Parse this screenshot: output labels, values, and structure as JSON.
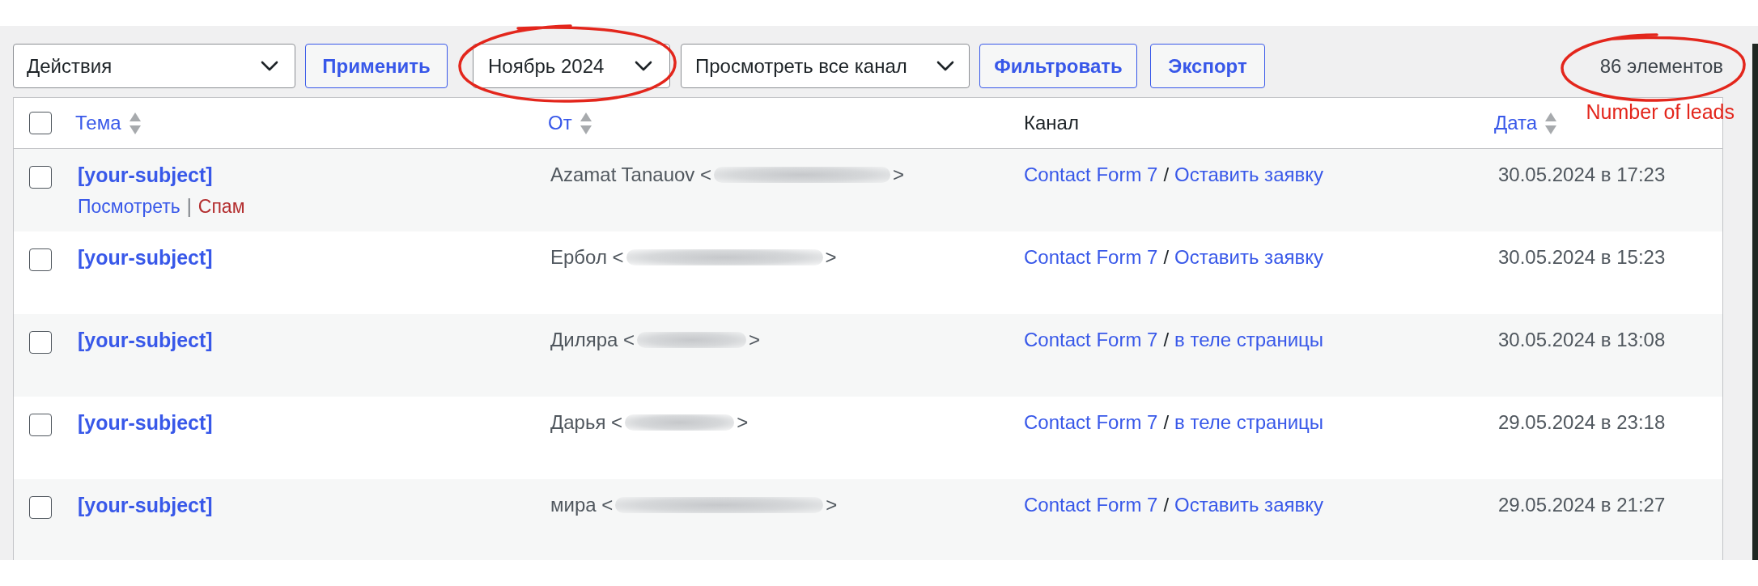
{
  "toolbar": {
    "bulk_action": {
      "value": "Действия"
    },
    "apply_button": {
      "label": "Применить"
    },
    "month_filter": {
      "value": "Ноябрь 2024",
      "circled": true
    },
    "channel_filter": {
      "value": "Просмотреть все канал"
    },
    "filter_button": {
      "label": "Фильтровать"
    },
    "export_button": {
      "label": "Экспорт"
    },
    "item_count": {
      "text": "86 элементов",
      "circled": true,
      "note": "Number of leads"
    }
  },
  "table": {
    "select_all": {
      "checked": false
    },
    "columns": [
      {
        "label": "Тема",
        "sortable": true
      },
      {
        "label": "От",
        "sortable": true
      },
      {
        "label": "Канал",
        "sortable": false
      },
      {
        "label": "Дата",
        "sortable": true
      }
    ],
    "rows": [
      {
        "checked": false,
        "subject": "[your-subject]",
        "actions": [
          {
            "label": "Посмотреть",
            "kind": "view"
          },
          {
            "label": "Спам",
            "kind": "spam"
          }
        ],
        "action_separator": "|",
        "sender": {
          "before": "Azamat Tanauov <",
          "after": ">"
        },
        "channel": {
          "source": "Contact Form 7",
          "separator": "/",
          "form": "Оставить заявку"
        },
        "date": "30.05.2024 в 17:23"
      },
      {
        "checked": false,
        "subject": "[your-subject]",
        "sender": {
          "before": "Ербол <",
          "after": ">"
        },
        "channel": {
          "source": "Contact Form 7",
          "separator": "/",
          "form": "Оставить заявку"
        },
        "date": "30.05.2024 в 15:23"
      },
      {
        "checked": false,
        "subject": "[your-subject]",
        "sender": {
          "before": "Диляра <",
          "after": ">"
        },
        "channel": {
          "source": "Contact Form 7",
          "separator": "/",
          "form": "в теле страницы"
        },
        "date": "30.05.2024 в 13:08"
      },
      {
        "checked": false,
        "subject": "[your-subject]",
        "sender": {
          "before": "Дарья <",
          "after": ">"
        },
        "channel": {
          "source": "Contact Form 7",
          "separator": "/",
          "form": "в теле страницы"
        },
        "date": "29.05.2024 в 23:18"
      },
      {
        "checked": false,
        "subject": "[your-subject]",
        "sender": {
          "before": "мира <",
          "after": ">"
        },
        "channel": {
          "source": "Contact Form 7",
          "separator": "/",
          "form": "Оставить заявку"
        },
        "date": "29.05.2024 в 21:27"
      }
    ]
  }
}
